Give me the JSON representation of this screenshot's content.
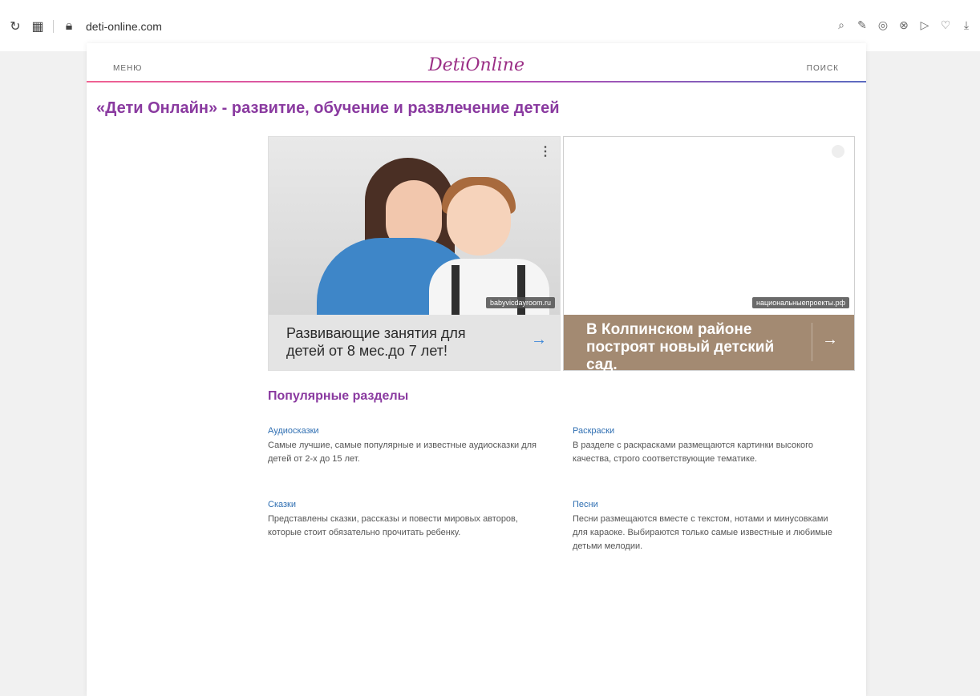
{
  "browser": {
    "url": "deti-online.com",
    "icons": [
      "refresh-icon",
      "tabs-grid-icon",
      "lock-icon",
      "search-icon",
      "edit-icon",
      "extension-icon",
      "shield-icon",
      "play-icon",
      "heart-icon",
      "download-icon"
    ]
  },
  "header": {
    "menu": "МЕНЮ",
    "logo": "DetiOnline",
    "search": "ПОИСК"
  },
  "page": {
    "title": "«Дети Онлайн» - развитие, обучение и развлечение детей"
  },
  "ads": {
    "left": {
      "domain": "babyvicdayroom.ru",
      "caption": "Развивающие занятия для детей от 8 мес.до 7 лет!"
    },
    "right": {
      "domain": "национальныепроекты.рф",
      "caption": "В Колпинском районе построят новый детский сад."
    }
  },
  "popular": {
    "title": "Популярные разделы",
    "sections": [
      {
        "title": "Аудиосказки",
        "desc": "Самые лучшие, самые популярные и известные аудиосказки для детей от 2-х до 15 лет."
      },
      {
        "title": "Раскраски",
        "desc": "В разделе с раскрасками размещаются картинки высокого качества, строго соответствующие тематике."
      },
      {
        "title": "Сказки",
        "desc": "Представлены сказки, рассказы и повести мировых авторов, которые стоит обязательно прочитать ребенку."
      },
      {
        "title": "Песни",
        "desc": "Песни размещаются вместе с текстом, нотами и минусовками для караоке. Выбираются только самые известные и любимые детьми мелодии."
      }
    ]
  },
  "colors": {
    "accent": "#8a3aa0",
    "link": "#2f6fb2",
    "ad_right_caption_bg": "#a38a72"
  }
}
